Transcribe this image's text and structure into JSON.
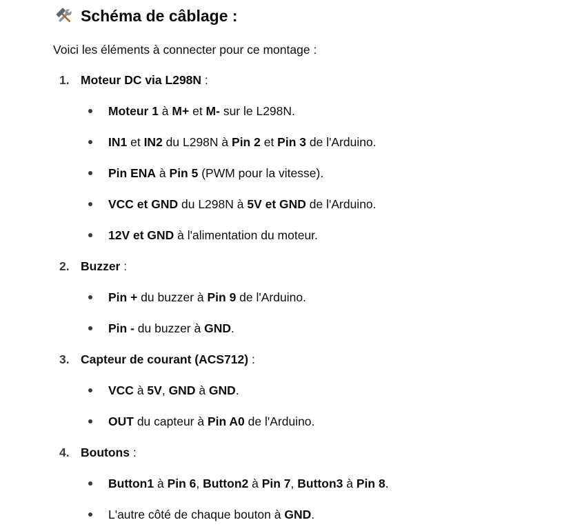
{
  "heading": {
    "icon": "hammer-and-wrench-icon",
    "text": "Schéma de câblage :"
  },
  "intro": "Voici les éléments à connecter pour ce montage :",
  "sections": [
    {
      "number": "1.",
      "title": "Moteur DC via L298N",
      "suffix": " :",
      "bullets": [
        [
          {
            "t": "Moteur 1",
            "b": true
          },
          {
            "t": " à "
          },
          {
            "t": "M+",
            "b": true
          },
          {
            "t": " et "
          },
          {
            "t": "M-",
            "b": true
          },
          {
            "t": " sur le L298N."
          }
        ],
        [
          {
            "t": "IN1",
            "b": true
          },
          {
            "t": " et "
          },
          {
            "t": "IN2",
            "b": true
          },
          {
            "t": " du L298N à "
          },
          {
            "t": "Pin 2",
            "b": true
          },
          {
            "t": " et "
          },
          {
            "t": "Pin 3",
            "b": true
          },
          {
            "t": " de l'Arduino."
          }
        ],
        [
          {
            "t": "Pin ENA",
            "b": true
          },
          {
            "t": " à "
          },
          {
            "t": "Pin 5",
            "b": true
          },
          {
            "t": " (PWM pour la vitesse)."
          }
        ],
        [
          {
            "t": "VCC et GND",
            "b": true
          },
          {
            "t": " du L298N à "
          },
          {
            "t": "5V et GND",
            "b": true
          },
          {
            "t": " de l'Arduino."
          }
        ],
        [
          {
            "t": "12V et GND",
            "b": true
          },
          {
            "t": " à l'alimentation du moteur."
          }
        ]
      ]
    },
    {
      "number": "2.",
      "title": "Buzzer",
      "suffix": " :",
      "bullets": [
        [
          {
            "t": "Pin +",
            "b": true
          },
          {
            "t": " du buzzer à "
          },
          {
            "t": "Pin 9",
            "b": true
          },
          {
            "t": " de l'Arduino."
          }
        ],
        [
          {
            "t": "Pin -",
            "b": true
          },
          {
            "t": " du buzzer à "
          },
          {
            "t": "GND",
            "b": true
          },
          {
            "t": "."
          }
        ]
      ]
    },
    {
      "number": "3.",
      "title": "Capteur de courant (ACS712)",
      "suffix": " :",
      "bullets": [
        [
          {
            "t": "VCC",
            "b": true
          },
          {
            "t": " à "
          },
          {
            "t": "5V",
            "b": true
          },
          {
            "t": ", "
          },
          {
            "t": "GND",
            "b": true
          },
          {
            "t": " à "
          },
          {
            "t": "GND",
            "b": true
          },
          {
            "t": "."
          }
        ],
        [
          {
            "t": "OUT",
            "b": true
          },
          {
            "t": " du capteur à "
          },
          {
            "t": "Pin A0",
            "b": true
          },
          {
            "t": " de l'Arduino."
          }
        ]
      ]
    },
    {
      "number": "4.",
      "title": "Boutons",
      "suffix": " :",
      "bullets": [
        [
          {
            "t": "Button1",
            "b": true
          },
          {
            "t": " à "
          },
          {
            "t": "Pin 6",
            "b": true
          },
          {
            "t": ", "
          },
          {
            "t": "Button2",
            "b": true
          },
          {
            "t": " à "
          },
          {
            "t": "Pin 7",
            "b": true
          },
          {
            "t": ", "
          },
          {
            "t": "Button3",
            "b": true
          },
          {
            "t": " à "
          },
          {
            "t": "Pin 8",
            "b": true
          },
          {
            "t": "."
          }
        ],
        [
          {
            "t": "L'autre côté de chaque bouton à "
          },
          {
            "t": "GND",
            "b": true
          },
          {
            "t": "."
          }
        ]
      ]
    }
  ]
}
